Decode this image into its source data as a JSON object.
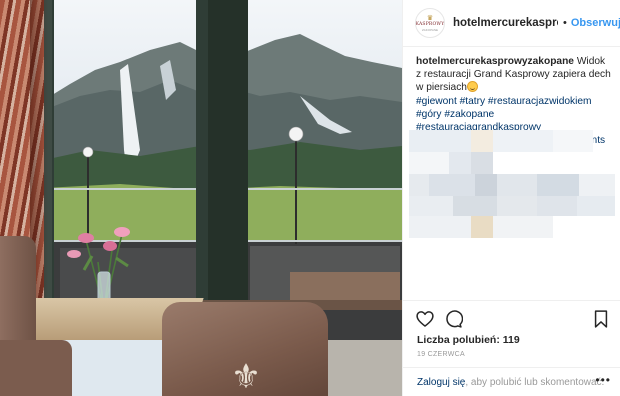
{
  "post": {
    "image_alt": "Restaurant Grand Kasprowy window view",
    "colors": {
      "frame": "#2f3d36",
      "mountain": "#6d7a78",
      "snow": "#eef2f4",
      "forest": "#3d5a3f",
      "meadow": "#8fae5c"
    }
  },
  "header": {
    "username": "hotelmercurekasprowyzakopane",
    "separator": "•",
    "follow_label": "Obserwuj",
    "avatar": {
      "crown": "♛",
      "brand": "KASPROWY",
      "sub": "ZAKOPANE"
    }
  },
  "caption": {
    "username": "hotelmercurekasprowyzakopane",
    "text": "Widok z restauracji Grand Kasprowy zapiera dech w piersiach",
    "hashtags": "#giewont #tatry #restauracjazwidokiem #góry #zakopane #restauracjagrandkasprowy #restauracjazakopane #beautifulmoments"
  },
  "actions": {
    "like_icon": "heart-icon",
    "comment_icon": "comment-icon",
    "save_icon": "bookmark-icon",
    "likes_label": "Liczba polubień: 119",
    "date": "19 CZERWCA"
  },
  "comment_bar": {
    "login_link": "Zaloguj się",
    "text": ", aby polubić lub skomentować.",
    "more_label": "•••"
  }
}
